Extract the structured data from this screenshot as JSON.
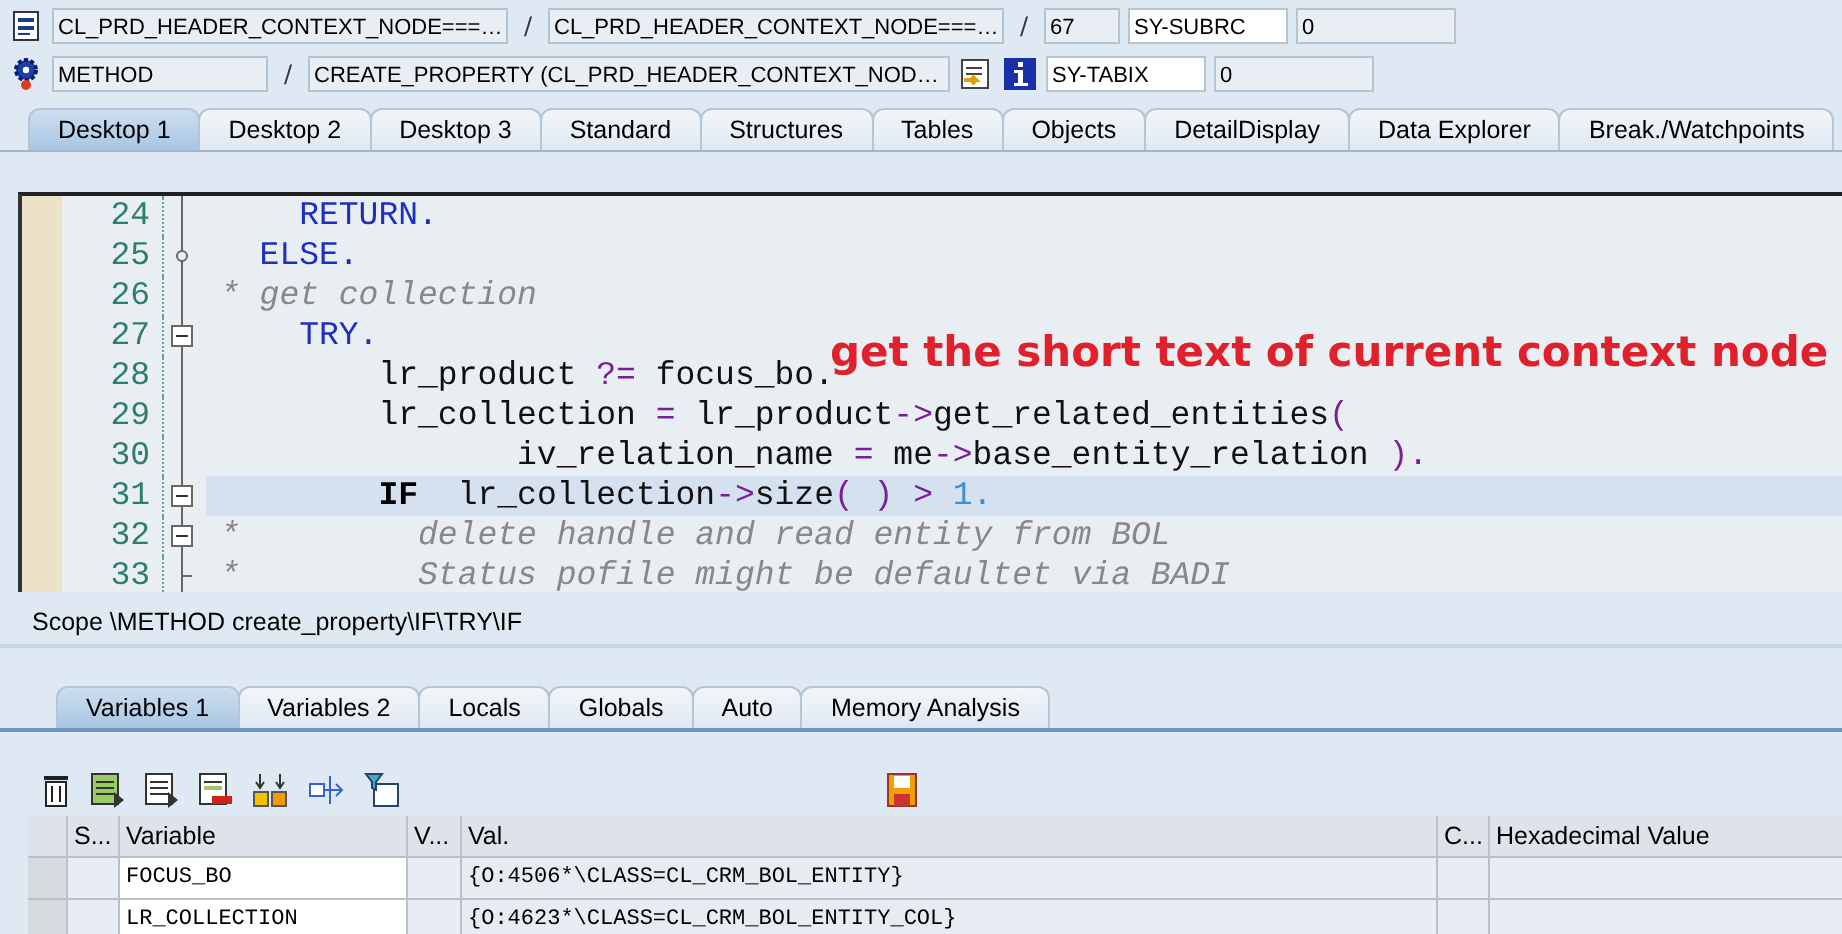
{
  "header": {
    "row_1": {
      "program": "CL_PRD_HEADER_CONTEXT_NODE===…",
      "separator_1": "/",
      "include": "CL_PRD_HEADER_CONTEXT_NODE===…",
      "separator_2": "/",
      "line": "67",
      "sysvar_name": "SY-SUBRC",
      "sysvar_value": "0"
    },
    "row_2": {
      "event_type": "METHOD",
      "separator": "/",
      "event": "CREATE_PROPERTY (CL_PRD_HEADER_CONTEXT_NOD…",
      "sysvar_name": "SY-TABIX",
      "sysvar_value": "0"
    }
  },
  "desktop_tabs": [
    {
      "label": "Desktop 1",
      "selected": true
    },
    {
      "label": "Desktop 2",
      "selected": false
    },
    {
      "label": "Desktop 3",
      "selected": false
    },
    {
      "label": "Standard",
      "selected": false
    },
    {
      "label": "Structures",
      "selected": false
    },
    {
      "label": "Tables",
      "selected": false
    },
    {
      "label": "Objects",
      "selected": false
    },
    {
      "label": "DetailDisplay",
      "selected": false
    },
    {
      "label": "Data Explorer",
      "selected": false
    },
    {
      "label": "Break./Watchpoints",
      "selected": false
    }
  ],
  "editor": {
    "lines": [
      {
        "number": "24",
        "kind": "line",
        "current": false,
        "tokens": [
          {
            "kind": "keyword",
            "text": "    RETURN."
          }
        ]
      },
      {
        "number": "25",
        "kind": "dot",
        "current": false,
        "tokens": [
          {
            "kind": "keyword",
            "text": "  ELSE."
          }
        ]
      },
      {
        "number": "26",
        "kind": "line",
        "current": false,
        "tokens": [
          {
            "kind": "comment",
            "text": "* get collection"
          }
        ]
      },
      {
        "number": "27",
        "kind": "box",
        "current": false,
        "tokens": [
          {
            "kind": "keyword",
            "text": "    TRY."
          }
        ]
      },
      {
        "number": "28",
        "kind": "line",
        "current": false,
        "tokens": [
          {
            "kind": "plain",
            "text": "        lr_product "
          },
          {
            "kind": "operator",
            "text": "?="
          },
          {
            "kind": "plain",
            "text": " focus_bo."
          }
        ]
      },
      {
        "number": "29",
        "kind": "line",
        "current": false,
        "tokens": [
          {
            "kind": "plain",
            "text": "        lr_collection "
          },
          {
            "kind": "operator",
            "text": "="
          },
          {
            "kind": "plain",
            "text": " lr_product"
          },
          {
            "kind": "operator",
            "text": "->"
          },
          {
            "kind": "plain",
            "text": "get_related_entities"
          },
          {
            "kind": "operator",
            "text": "("
          }
        ]
      },
      {
        "number": "30",
        "kind": "line",
        "current": false,
        "tokens": [
          {
            "kind": "plain",
            "text": "               iv_relation_name "
          },
          {
            "kind": "operator",
            "text": "="
          },
          {
            "kind": "plain",
            "text": " me"
          },
          {
            "kind": "operator",
            "text": "->"
          },
          {
            "kind": "plain",
            "text": "base_entity_relation "
          },
          {
            "kind": "operator",
            "text": ")."
          }
        ]
      },
      {
        "number": "31",
        "kind": "box",
        "current": true,
        "tokens": [
          {
            "kind": "bold",
            "text": "        IF"
          },
          {
            "kind": "plain",
            "text": "  lr_collection"
          },
          {
            "kind": "operator",
            "text": "->"
          },
          {
            "kind": "plain",
            "text": "size"
          },
          {
            "kind": "operator",
            "text": "( ) >"
          },
          {
            "kind": "number",
            "text": " 1."
          }
        ]
      },
      {
        "number": "32",
        "kind": "box",
        "current": false,
        "tokens": [
          {
            "kind": "comment",
            "text": "*         delete handle and read entity from BOL"
          }
        ]
      },
      {
        "number": "33",
        "kind": "end",
        "current": false,
        "tokens": [
          {
            "kind": "comment",
            "text": "*         Status pofile might be defaultet via BADI"
          }
        ]
      }
    ],
    "annotation": "get the short text of current context node"
  },
  "scope": "Scope \\METHOD create_property\\IF\\TRY\\IF",
  "variable_tabs": [
    {
      "label": "Variables 1",
      "selected": true
    },
    {
      "label": "Variables 2",
      "selected": false
    },
    {
      "label": "Locals",
      "selected": false
    },
    {
      "label": "Globals",
      "selected": false
    },
    {
      "label": "Auto",
      "selected": false
    },
    {
      "label": "Memory Analysis",
      "selected": false
    }
  ],
  "table": {
    "columns": [
      "S...",
      "Variable",
      "V...",
      "Val.",
      "C...",
      "Hexadecimal Value"
    ],
    "rows": [
      {
        "variable": "FOCUS_BO",
        "value": "{O:4506*\\CLASS=CL_CRM_BOL_ENTITY}"
      },
      {
        "variable": "LR_COLLECTION",
        "value": "{O:4623*\\CLASS=CL_CRM_BOL_ENTITY_COL}"
      }
    ]
  }
}
